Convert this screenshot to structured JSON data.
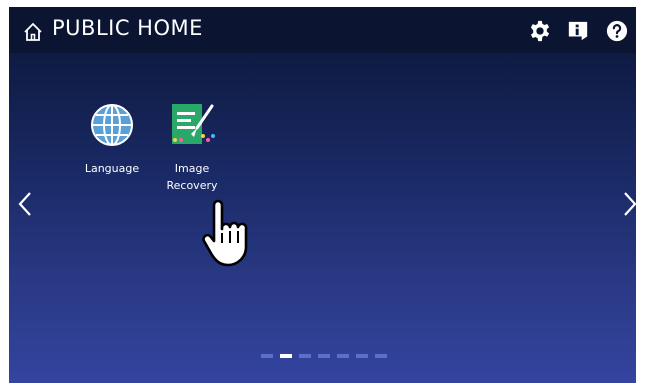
{
  "header": {
    "title": "PUBLIC HOME",
    "icons": [
      "home-icon",
      "gear-icon",
      "info-icon",
      "help-icon"
    ]
  },
  "apps": [
    {
      "label": "Language",
      "icon": "globe-icon"
    },
    {
      "label": "Image\nRecovery",
      "icon": "image-recovery-icon"
    }
  ],
  "pagination": {
    "total": 7,
    "current": 2
  },
  "navigation": {
    "left_icon": "chevron-left-icon",
    "right_icon": "chevron-right-icon"
  },
  "colors": {
    "background_top": "#0a1535",
    "background_bottom": "#3444a0",
    "topbar": "#0b1430",
    "globe": "#5a9fd6",
    "document_green": "#2aa86a",
    "dot_inactive": "#5b6fcc",
    "dot_active": "#ffffff"
  }
}
